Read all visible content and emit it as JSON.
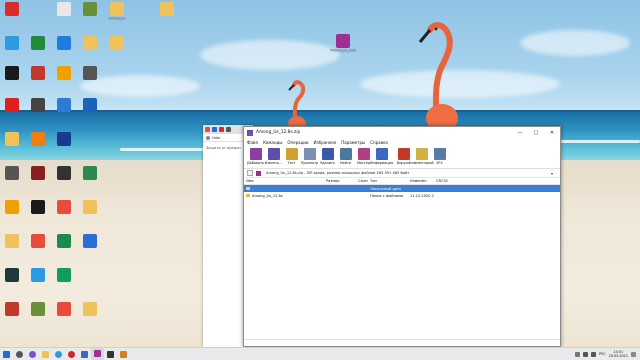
{
  "desktop": {
    "icons": [
      {
        "label": "",
        "color": "#d92c2c"
      },
      {
        "label": "",
        "color": "#e8e8e8"
      },
      {
        "label": "",
        "color": "#6a8f3a"
      },
      {
        "label": "among_us",
        "color": "#f0c35a"
      },
      {
        "label": "",
        "color": "#f0c35a"
      },
      {
        "label": "",
        "color": "#2e9be0"
      },
      {
        "label": "",
        "color": "#1f8c3a"
      },
      {
        "label": "",
        "color": "#1f7de0"
      },
      {
        "label": "",
        "color": "#f0c35a"
      },
      {
        "label": "",
        "color": "#f0c35a"
      },
      {
        "label": "",
        "color": "#1a1a1a"
      },
      {
        "label": "",
        "color": "#c0392b"
      },
      {
        "label": "",
        "color": "#f0a000"
      },
      {
        "label": "",
        "color": "#555555"
      },
      {
        "label": "",
        "color": "#e02020"
      },
      {
        "label": "",
        "color": "#444444"
      },
      {
        "label": "",
        "color": "#2e7bd6"
      },
      {
        "label": "",
        "color": "#1c62b8"
      },
      {
        "label": "",
        "color": "#f0c35a"
      },
      {
        "label": "",
        "color": "#f07d10"
      },
      {
        "label": "",
        "color": "#1a3a8f"
      },
      {
        "label": "",
        "color": "#555555"
      },
      {
        "label": "",
        "color": "#8a1f1f"
      },
      {
        "label": "",
        "color": "#333333"
      },
      {
        "label": "",
        "color": "#2c8a4a"
      },
      {
        "label": "",
        "color": "#f0a000"
      },
      {
        "label": "",
        "color": "#1a1a1a"
      },
      {
        "label": "",
        "color": "#e84b3c"
      },
      {
        "label": "",
        "color": "#f0c35a"
      },
      {
        "label": "",
        "color": "#f0c35a"
      },
      {
        "label": "",
        "color": "#e84b3c"
      },
      {
        "label": "",
        "color": "#1c8c4a"
      },
      {
        "label": "",
        "color": "#2b6fd6"
      },
      {
        "label": "",
        "color": "#1d3b3b"
      },
      {
        "label": "",
        "color": "#2b9be0"
      },
      {
        "label": "",
        "color": "#0f9d58"
      },
      {
        "label": "",
        "color": "#c0392b"
      },
      {
        "label": "",
        "color": "#6a8f3a"
      },
      {
        "label": "",
        "color": "#e84b3c"
      },
      {
        "label": "",
        "color": "#f0c35a"
      },
      {
        "label": "Among_Us_12.8s",
        "color": "#9b2f93"
      }
    ]
  },
  "browser": {
    "address": "Hdar",
    "content_text": "Защита от вредон"
  },
  "winrar": {
    "title": "Among_Us_12.8s.zip",
    "menu": [
      "Файл",
      "Команды",
      "Операции",
      "Избранное",
      "Параметры",
      "Справка"
    ],
    "toolbar": [
      {
        "label": "Добавить",
        "color": "#8a3fa0"
      },
      {
        "label": "Извлечь...",
        "color": "#5d4fa8"
      },
      {
        "label": "Тест",
        "color": "#d0a030"
      },
      {
        "label": "Просмотр",
        "color": "#7b90b0"
      },
      {
        "label": "Удалить",
        "color": "#3a5aa8"
      },
      {
        "label": "Найти",
        "color": "#4a7a9a"
      },
      {
        "label": "Мастер",
        "color": "#b04080"
      },
      {
        "label": "Информация",
        "color": "#3a6ac0"
      },
      {
        "label": "Вирусы",
        "color": "#c03a2a"
      },
      {
        "label": "Комментарий",
        "color": "#d0b040"
      },
      {
        "label": "SFX",
        "color": "#5a7aa8"
      }
    ],
    "path": "Among_Us_12.8s.zip - ZIP архив, размер исходных файлов 263 391 465 байт",
    "columns": [
      "Имя",
      "Размер",
      "Сжат",
      "Тип",
      "Изменён",
      "CRC32"
    ],
    "rows": [
      {
        "name": "..",
        "size": "",
        "packed": "",
        "type": "Локальный диск",
        "modified": "",
        "crc": "",
        "selected": true
      },
      {
        "name": "Among_Us_12.8s",
        "size": "",
        "packed": "",
        "type": "Папка с файлами",
        "modified": "11.12.2020 17:28",
        "crc": "",
        "selected": false
      }
    ]
  },
  "taskbar": {
    "lang": "РУС",
    "time": "13:01",
    "date": "20.03.2021",
    "apps": [
      {
        "name": "start",
        "color": "#1f6fd0"
      },
      {
        "name": "search",
        "color": "#555555"
      },
      {
        "name": "cortana",
        "color": "#7a4fd0"
      },
      {
        "name": "explorer",
        "color": "#f0c35a"
      },
      {
        "name": "chrome",
        "color": "#2e9be0"
      },
      {
        "name": "yandex",
        "color": "#e02020"
      },
      {
        "name": "app",
        "color": "#3a6ac0"
      },
      {
        "name": "winrar",
        "color": "#9b2f93"
      },
      {
        "name": "media",
        "color": "#333333"
      },
      {
        "name": "app2",
        "color": "#d08020"
      }
    ]
  }
}
